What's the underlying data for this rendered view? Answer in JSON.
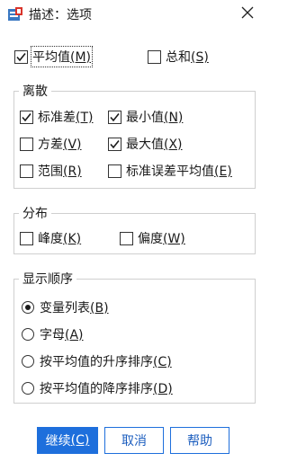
{
  "window": {
    "title": "描述：选项",
    "icon": "spss-descriptives-icon",
    "close_icon": "close-icon"
  },
  "top_options": [
    {
      "label": "平均值",
      "key": "(M)",
      "checked": true
    },
    {
      "label": "总和",
      "key": "(S)",
      "checked": false
    }
  ],
  "dispersion": {
    "legend": "离散",
    "items": [
      {
        "label": "标准差",
        "key": "(T)",
        "checked": true
      },
      {
        "label": "最小值",
        "key": "(N)",
        "checked": true
      },
      {
        "label": "方差",
        "key": "(V)",
        "checked": false
      },
      {
        "label": "最大值",
        "key": "(X)",
        "checked": true
      },
      {
        "label": "范围",
        "key": "(R)",
        "checked": false
      },
      {
        "label": "标准误差平均值",
        "key": "(E)",
        "checked": false
      }
    ]
  },
  "distribution": {
    "legend": "分布",
    "items": [
      {
        "label": "峰度",
        "key": "(K)",
        "checked": false
      },
      {
        "label": "偏度",
        "key": "(W)",
        "checked": false
      }
    ]
  },
  "display_order": {
    "legend": "显示顺序",
    "options": [
      {
        "label": "变量列表",
        "key": "(B)",
        "selected": true
      },
      {
        "label": "字母",
        "key": "(A)",
        "selected": false
      },
      {
        "label": "按平均值的升序排序",
        "key": "(C)",
        "selected": false
      },
      {
        "label": "按平均值的降序排序",
        "key": "(D)",
        "selected": false
      }
    ]
  },
  "buttons": {
    "continue": {
      "label": "继续",
      "key": "(C)"
    },
    "cancel": "取消",
    "help": "帮助"
  },
  "colors": {
    "primary": "#1e6fdc",
    "check": "#1a1a1a"
  }
}
